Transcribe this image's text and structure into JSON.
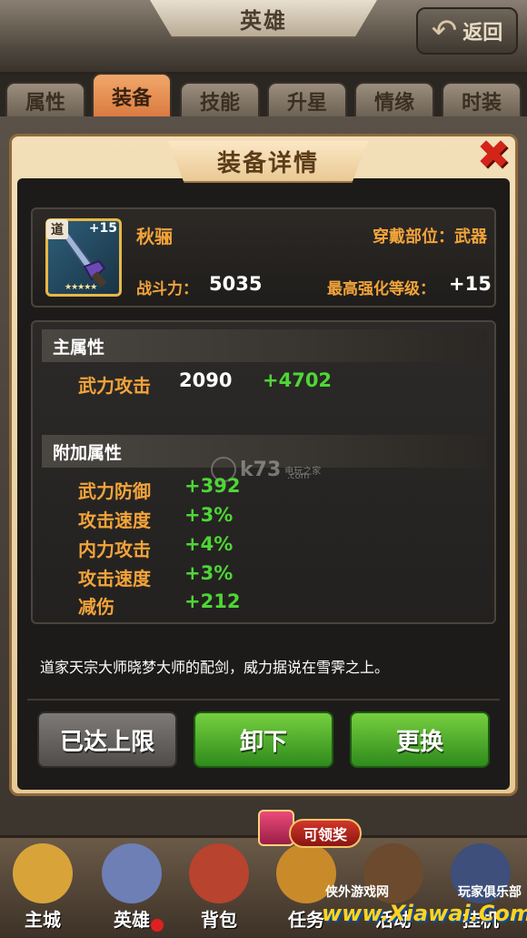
{
  "header": {
    "title": "英雄",
    "back_label": "返回"
  },
  "tabs": [
    {
      "label": "属性",
      "active": false
    },
    {
      "label": "装备",
      "active": true
    },
    {
      "label": "技能",
      "active": false
    },
    {
      "label": "升星",
      "active": false
    },
    {
      "label": "情缘",
      "active": false
    },
    {
      "label": "时装",
      "active": false
    }
  ],
  "modal": {
    "title": "装备详情",
    "item": {
      "tag": "道",
      "plus": "+15",
      "stars": "★★★★★",
      "name": "秋骊",
      "slot_text": "穿戴部位：武器",
      "power_label": "战斗力：",
      "power_value": "5035",
      "max_level_label": "最高强化等级：",
      "max_level_value": "+15"
    },
    "main_attr": {
      "heading": "主属性",
      "name": "武力攻击",
      "base": "2090",
      "bonus": "+4702"
    },
    "extra_attr": {
      "heading": "附加属性",
      "rows": [
        {
          "name": "武力防御",
          "value": "+392"
        },
        {
          "name": "攻击速度",
          "value": "+3%"
        },
        {
          "name": "内力攻击",
          "value": "+4%"
        },
        {
          "name": "攻击速度",
          "value": "+3%"
        },
        {
          "name": "减伤",
          "value": "+212"
        }
      ]
    },
    "description": "道家天宗大师晓梦大师的配剑，威力据说在雪霁之上。",
    "buttons": {
      "maxed": "已达上限",
      "unequip": "卸下",
      "replace": "更换"
    }
  },
  "watermark": {
    "brand": "k73",
    "sub1": "电玩之家",
    "sub2": ".com"
  },
  "bottom_nav": {
    "items": [
      {
        "label": "主城",
        "color": "#d8a43a"
      },
      {
        "label": "英雄",
        "color": "#6d7fb5"
      },
      {
        "label": "背包",
        "color": "#b8432e"
      },
      {
        "label": "任务",
        "color": "#c98a2a"
      },
      {
        "label": "活动",
        "color": "#6b4a2e"
      },
      {
        "label": "挂机",
        "color": "#3d4f7a"
      }
    ],
    "reward_badge": "可领奖"
  },
  "site_watermark": {
    "left": "侠外游戏网",
    "right": "玩家俱乐部",
    "url": "www.Xiawai.Com"
  }
}
